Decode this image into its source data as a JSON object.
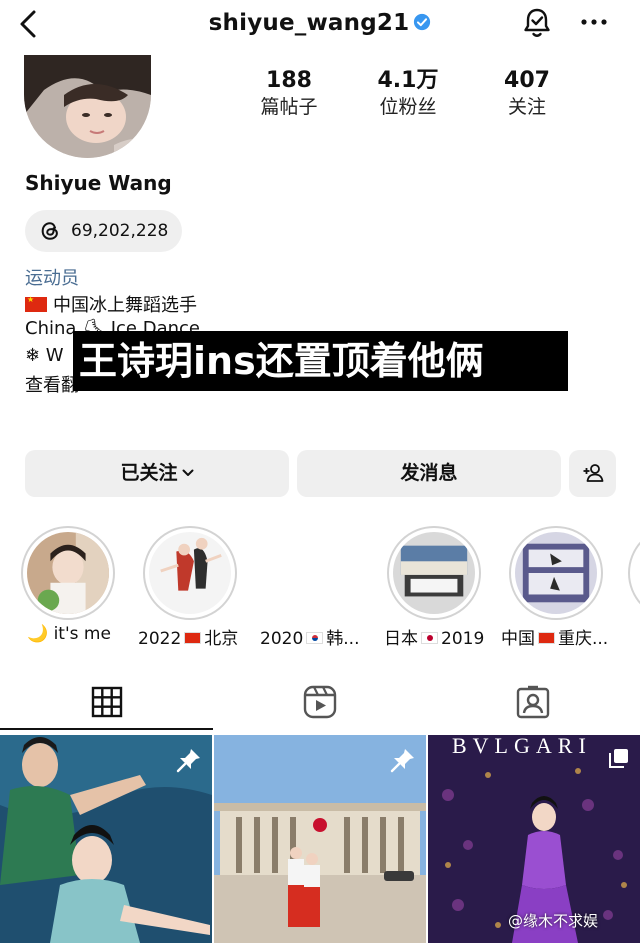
{
  "header": {
    "username": "shiyue_wang21",
    "verified": true,
    "verified_color": "#3897f0"
  },
  "profile": {
    "display_name": "Shiyue Wang",
    "threads_count": "69,202,228",
    "stats": [
      {
        "value": "188",
        "label": "篇帖子"
      },
      {
        "value": "4.1万",
        "label": "位粉丝"
      },
      {
        "value": "407",
        "label": "关注"
      }
    ]
  },
  "bio": {
    "category": "运动员",
    "category_color": "#4a6d92",
    "line1": "中国冰上舞蹈选手",
    "line2": "China ⛸ Ice Dance",
    "line3": "❄ W",
    "line4": "查看翻"
  },
  "overlay_caption": "王诗玥ins还置顶着他俩",
  "actions": {
    "following": "已关注",
    "message": "发消息"
  },
  "highlights": [
    {
      "label": "🌙 it's me"
    },
    {
      "label_pre": "2022",
      "label_post": "北京",
      "flag": "cn"
    },
    {
      "label_pre": "2020",
      "label_post": "韩...",
      "flag": "kr"
    },
    {
      "label_pre": "日本",
      "label_post": "2019",
      "flag": "jp"
    },
    {
      "label_pre": "中国",
      "label_post": "重庆...",
      "flag": "cn"
    }
  ],
  "tabs": [
    "grid-icon",
    "reels-icon",
    "tagged-icon"
  ],
  "posts": [
    {
      "pinned": true
    },
    {
      "pinned": true
    },
    {
      "brand": "BVLGARI",
      "multi": true
    }
  ],
  "watermark": "@缘木不求娱"
}
